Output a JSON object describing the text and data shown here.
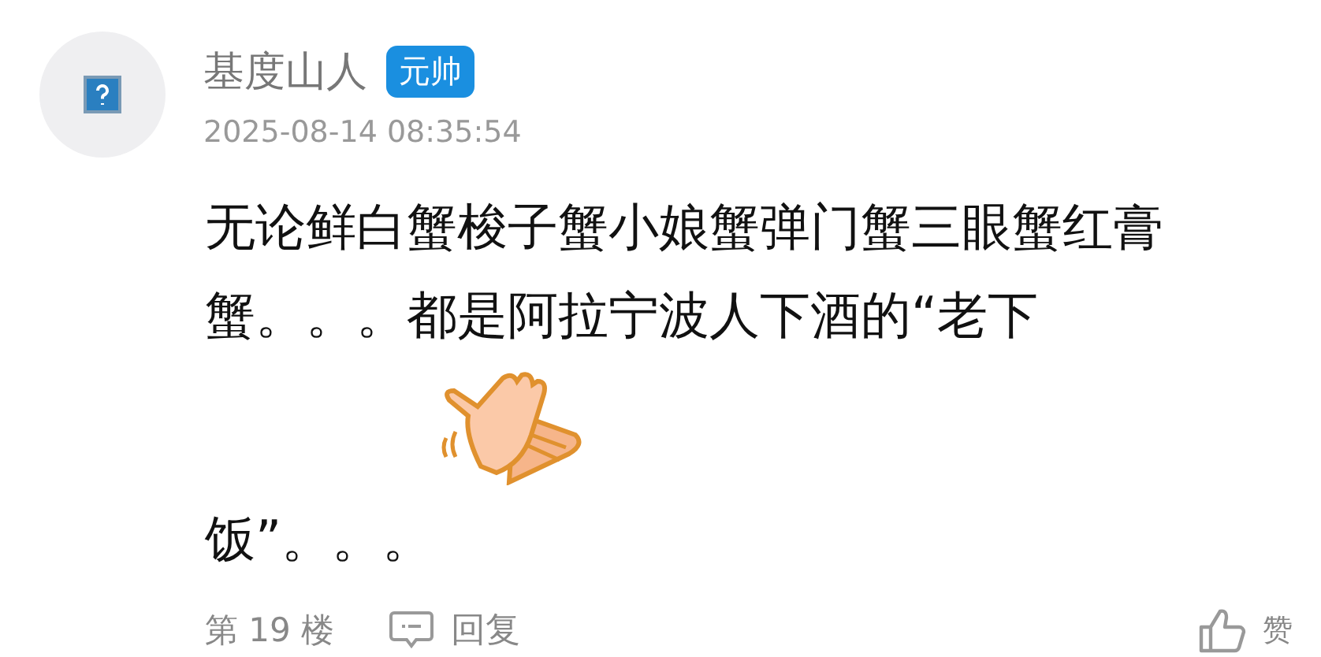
{
  "post": {
    "author": "基度山人",
    "badge": "元帅",
    "time": "2025-08-14 08:35:54",
    "content": [
      {
        "kind": "text",
        "text": "无论鲜白蟹梭子蟹小娘蟹弹门蟹三眼蟹红膏蟹。。。都是阿拉宁波人下酒的“老下"
      },
      {
        "kind": "sticker"
      },
      {
        "kind": "text",
        "text": "饭”。。。"
      }
    ],
    "floor": "第 19 楼",
    "reply": "回复",
    "like": "赞"
  }
}
